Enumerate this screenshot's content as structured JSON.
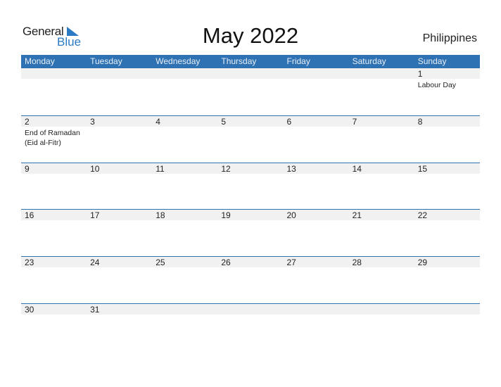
{
  "logo": {
    "word1": "General",
    "word2": "Blue"
  },
  "title": "May 2022",
  "country": "Philippines",
  "colors": {
    "accent": "#2e72b3",
    "strip": "#f1f1f1"
  },
  "weekdays": [
    "Monday",
    "Tuesday",
    "Wednesday",
    "Thursday",
    "Friday",
    "Saturday",
    "Sunday"
  ],
  "weeks": [
    [
      {
        "d": ""
      },
      {
        "d": ""
      },
      {
        "d": ""
      },
      {
        "d": ""
      },
      {
        "d": ""
      },
      {
        "d": ""
      },
      {
        "d": "1",
        "h": "Labour Day"
      }
    ],
    [
      {
        "d": "2",
        "h": "End of Ramadan (Eid al-Fitr)"
      },
      {
        "d": "3"
      },
      {
        "d": "4"
      },
      {
        "d": "5"
      },
      {
        "d": "6"
      },
      {
        "d": "7"
      },
      {
        "d": "8"
      }
    ],
    [
      {
        "d": "9"
      },
      {
        "d": "10"
      },
      {
        "d": "11"
      },
      {
        "d": "12"
      },
      {
        "d": "13"
      },
      {
        "d": "14"
      },
      {
        "d": "15"
      }
    ],
    [
      {
        "d": "16"
      },
      {
        "d": "17"
      },
      {
        "d": "18"
      },
      {
        "d": "19"
      },
      {
        "d": "20"
      },
      {
        "d": "21"
      },
      {
        "d": "22"
      }
    ],
    [
      {
        "d": "23"
      },
      {
        "d": "24"
      },
      {
        "d": "25"
      },
      {
        "d": "26"
      },
      {
        "d": "27"
      },
      {
        "d": "28"
      },
      {
        "d": "29"
      }
    ],
    [
      {
        "d": "30"
      },
      {
        "d": "31"
      },
      {
        "d": ""
      },
      {
        "d": ""
      },
      {
        "d": ""
      },
      {
        "d": ""
      },
      {
        "d": ""
      }
    ]
  ]
}
